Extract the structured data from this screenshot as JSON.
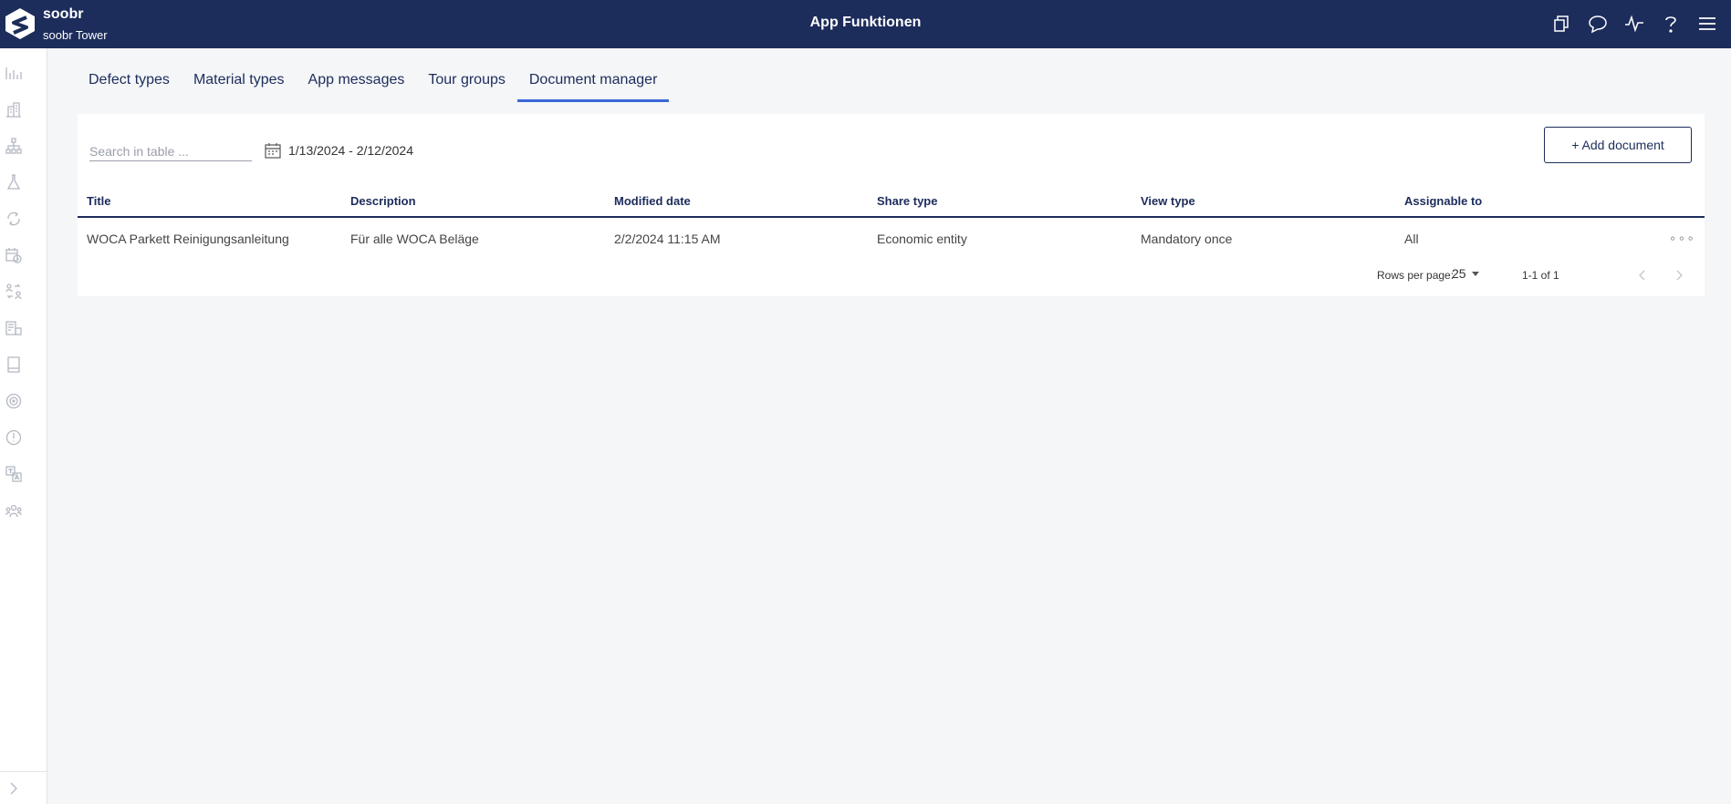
{
  "header": {
    "brand_name": "soobr",
    "brand_sub": "soobr Tower",
    "title": "App Funktionen",
    "icons": [
      "copy-icon",
      "chat-icon",
      "activity-icon",
      "help-icon",
      "menu-icon"
    ]
  },
  "sidebar": {
    "icons": [
      "analytics-icon",
      "building-icon",
      "hierarchy-icon",
      "lab-icon",
      "sync-icon",
      "calendar-clock-icon",
      "user-swap-icon",
      "document-building-icon",
      "book-icon",
      "target-icon",
      "alert-icon",
      "translate-icon",
      "team-icon"
    ],
    "expand_icon": "chevron-right-icon"
  },
  "tabs": [
    {
      "label": "Defect types",
      "active": false
    },
    {
      "label": "Material types",
      "active": false
    },
    {
      "label": "App messages",
      "active": false
    },
    {
      "label": "Tour groups",
      "active": false
    },
    {
      "label": "Document manager",
      "active": true
    }
  ],
  "toolbar": {
    "search_placeholder": "Search in table ...",
    "date_range": "1/13/2024 - 2/12/2024",
    "add_label": "+ Add document"
  },
  "table": {
    "columns": [
      "Title",
      "Description",
      "Modified date",
      "Share type",
      "View type",
      "Assignable to"
    ],
    "rows": [
      [
        "WOCA Parkett Reinigungsanleitung",
        "Für alle WOCA Beläge",
        "2/2/2024 11:15 AM",
        "Economic entity",
        "Mandatory once",
        "All"
      ]
    ],
    "row_menu": "∘∘∘"
  },
  "pagination": {
    "rows_label": "Rows per page:",
    "rows_value": "25",
    "count": "1-1 of 1"
  },
  "colors": {
    "navy": "#1c2c5b",
    "accent": "#3a68d8",
    "background": "#f5f6f8"
  }
}
